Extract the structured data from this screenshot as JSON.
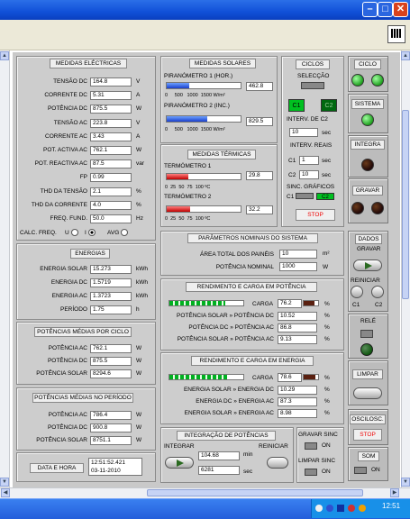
{
  "window": {
    "min": "–",
    "max": "□",
    "close": "✕"
  },
  "electrical": {
    "title": "MEDIDAS ELÉCTRICAS",
    "rows": [
      {
        "label": "TENSÃO DC",
        "value": "164.8",
        "unit": "V"
      },
      {
        "label": "CORRENTE DC",
        "value": "5.31",
        "unit": "A"
      },
      {
        "label": "POTÊNCIA DC",
        "value": "875.5",
        "unit": "W"
      },
      {
        "label": "TENSÃO AC",
        "value": "223.8",
        "unit": "V"
      },
      {
        "label": "CORRENTE AC",
        "value": "3.43",
        "unit": "A"
      },
      {
        "label": "POT. ACTIVA AC",
        "value": "762.1",
        "unit": "W"
      },
      {
        "label": "POT. REACTIVA AC",
        "value": "87.5",
        "unit": "var"
      },
      {
        "label": "FP",
        "value": "0.99",
        "unit": ""
      },
      {
        "label": "THD DA TENSÃO",
        "value": "2.1",
        "unit": "%"
      },
      {
        "label": "THD DA CORRENTE",
        "value": "4.0",
        "unit": "%"
      },
      {
        "label": "FREQ. FUND.",
        "value": "50.0",
        "unit": "Hz"
      }
    ],
    "calc_label": "CALC. FREQ.",
    "opt_u": "U",
    "opt_i": "I",
    "opt_avg": "AVG"
  },
  "energy": {
    "title": "ENERGIAS",
    "rows": [
      {
        "label": "ENERGIA SOLAR",
        "value": "15.273",
        "unit": "kWh"
      },
      {
        "label": "ENERGIA DC",
        "value": "1.5719",
        "unit": "kWh"
      },
      {
        "label": "ENERGIA AC",
        "value": "1.3723",
        "unit": "kWh"
      },
      {
        "label": "PERÍODO",
        "value": "1.75",
        "unit": "h"
      }
    ]
  },
  "avg_cycle": {
    "title": "POTÊNCIAS MÉDIAS POR CICLO",
    "rows": [
      {
        "label": "POTÊNCIA AC",
        "value": "762.1",
        "unit": "W"
      },
      {
        "label": "POTÊNCIA DC",
        "value": "875.5",
        "unit": "W"
      },
      {
        "label": "POTÊNCIA SOLAR",
        "value": "8294.6",
        "unit": "W"
      }
    ]
  },
  "avg_period": {
    "title": "POTÊNCIAS MÉDIAS NO PERÍODO",
    "rows": [
      {
        "label": "POTÊNCIA AC",
        "value": "786.4",
        "unit": "W"
      },
      {
        "label": "POTÊNCIA DC",
        "value": "900.8",
        "unit": "W"
      },
      {
        "label": "POTÊNCIA SOLAR",
        "value": "8751.1",
        "unit": "W"
      }
    ]
  },
  "datetime": {
    "label": "DATA E HORA",
    "time": "12:51:52.421",
    "date": "03-11-2010"
  },
  "solar": {
    "title": "MEDIDAS SOLARES",
    "pyr1": {
      "label": "PIRANÓMETRO 1 (HOR.)",
      "value": "462.8",
      "level": 0.308
    },
    "pyr2": {
      "label": "PIRANÓMETRO 2 (INC.)",
      "value": "829.5",
      "level": 0.553
    },
    "ticks": [
      "0",
      "500",
      "1000",
      "1500 W/m²"
    ]
  },
  "thermal": {
    "title": "MEDIDAS TÉRMICAS",
    "t1": {
      "label": "TERMÓMETRO 1",
      "value": "29.8",
      "level": 0.298
    },
    "t2": {
      "label": "TERMÓMETRO 2",
      "value": "32.2",
      "level": 0.322
    },
    "ticks": [
      "0",
      "25",
      "50",
      "75",
      "100 ºC"
    ]
  },
  "cycles": {
    "title": "CICLOS",
    "selection": "SELECÇÃO",
    "c1": "C1",
    "c2": "C2",
    "interv_c2": "INTERV. DE C2",
    "interv_c2_val": "10",
    "sec": "sec",
    "interv_real": "INTERV. REAIS",
    "c1_val": "1",
    "c2_val": "10",
    "sync": "SINC. GRÁFICOS",
    "sync_c1": "C1",
    "sync_c2": "C2",
    "stop": "STOP"
  },
  "nominal": {
    "title": "PARÂMETROS NOMINAIS DO SISTEMA",
    "area_label": "ÁREA TOTAL DOS PAINÉIS",
    "area_val": "10",
    "area_unit": "m²",
    "pow_label": "POTÊNCIA NOMINAL",
    "pow_val": "1000",
    "pow_unit": "W"
  },
  "perf_power": {
    "title": "RENDIMENTO E CARGA  EM POTÊNCIA",
    "load_label": "CARGA",
    "load_val": "76.2",
    "load_level": 0.762,
    "load_unit": "%",
    "rows": [
      {
        "label": "POTÊNCIA SOLAR » POTÊNCIA DC",
        "value": "10.52",
        "unit": "%"
      },
      {
        "label": "POTÊNCIA DC » POTÊNCIA AC",
        "value": "86.8",
        "unit": "%"
      },
      {
        "label": "POTÊNCIA SOLAR » POTÊNCIA AC",
        "value": "9.13",
        "unit": "%"
      }
    ]
  },
  "perf_energy": {
    "title": "RENDIMENTO E CARGA EM ENERGIA",
    "load_label": "CARGA",
    "load_val": "78.6",
    "load_level": 0.786,
    "load_unit": "%",
    "rows": [
      {
        "label": "ENERGIA SOLAR » ENERGIA DC",
        "value": "10.29",
        "unit": "%"
      },
      {
        "label": "ENERGIA DC » ENERGIA AC",
        "value": "87.3",
        "unit": "%"
      },
      {
        "label": "ENERGIA SOLAR » ENERGIA AC",
        "value": "8.98",
        "unit": "%"
      }
    ]
  },
  "integration": {
    "title": "INTEGRAÇÃO DE POTÊNCIAS",
    "integrate": "INTEGRAR",
    "restart": "REINICIAR",
    "min_val": "104.68",
    "min_unit": "min",
    "sec_val": "6281",
    "sec_unit": "sec"
  },
  "sync_save": {
    "title": "GRAVAR SINC",
    "on": "ON",
    "clear": "LIMPAR SINC",
    "on2": "ON"
  },
  "side": {
    "cycle": "CICLO",
    "system": "SISTEMA",
    "integra": "INTEGRA",
    "save": "GRAVAR",
    "data": "DADOS",
    "data_save": "GRAVAR",
    "restart": "REINICIAR",
    "c1": "C1",
    "c2": "C2",
    "relay": "RELÉ",
    "clear": "LIMPAR",
    "osc": "OSCILOSC.",
    "stop": "STOP",
    "som": "SOM",
    "on": "ON"
  },
  "clock": "12:51"
}
